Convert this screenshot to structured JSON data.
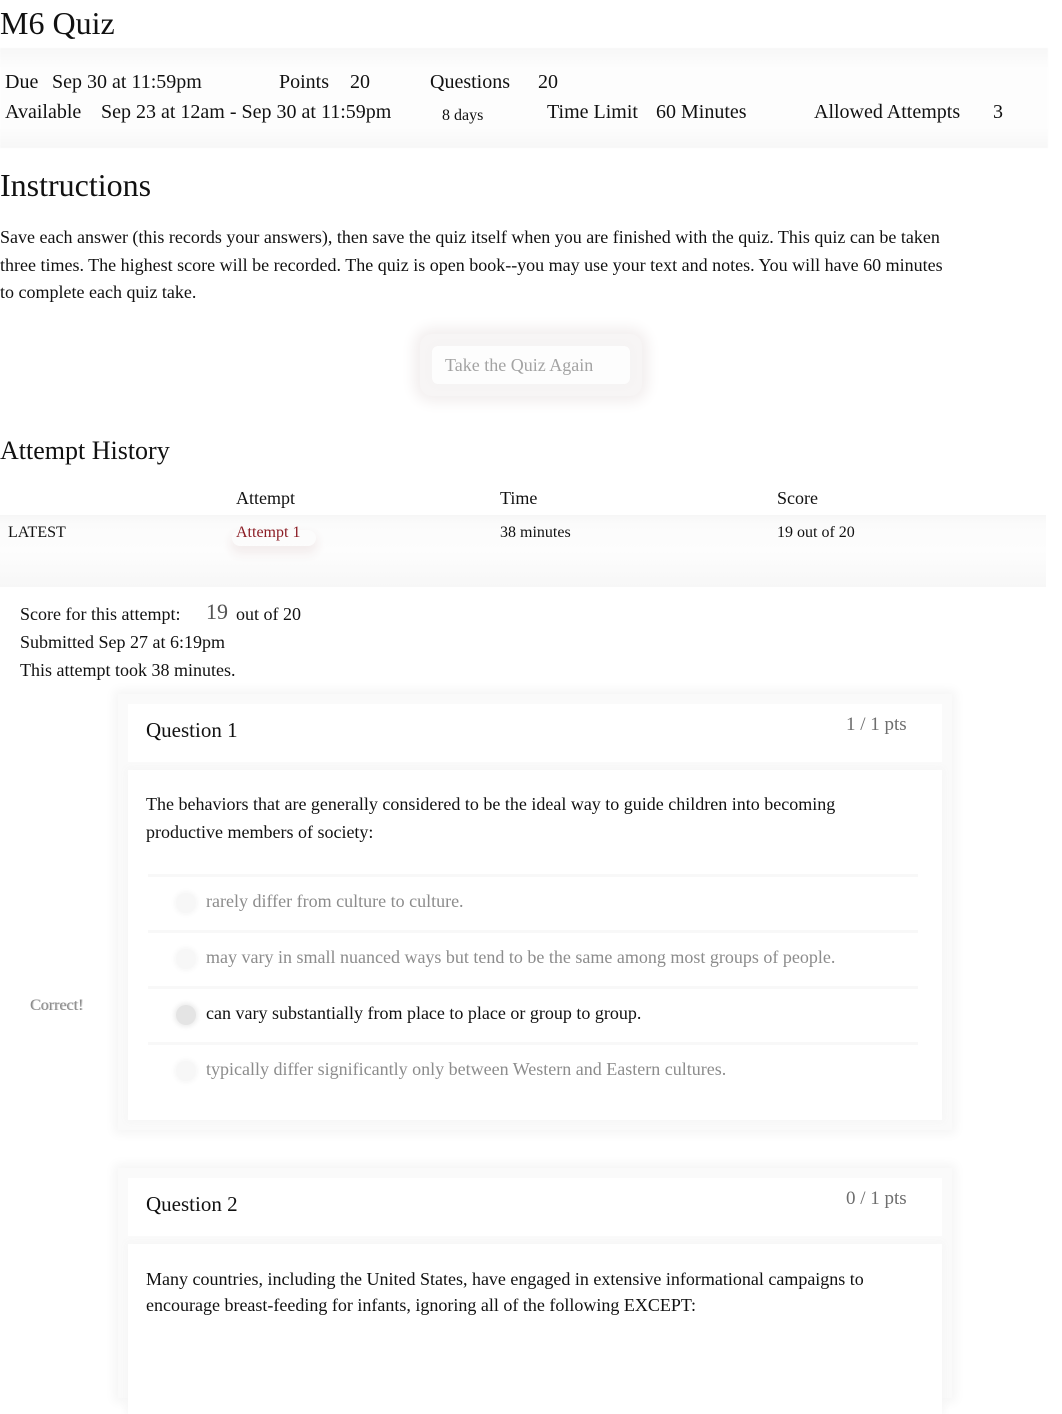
{
  "page": {
    "title": "M6 Quiz"
  },
  "details": {
    "due_label": "Due",
    "due_value": "Sep 30 at 11:59pm",
    "points_label": "Points",
    "points_value": "20",
    "questions_label": "Questions",
    "questions_value": "20",
    "available_label": "Available",
    "available_value": "Sep 23 at 12am - Sep 30 at 11:59pm",
    "available_duration": "8 days",
    "time_limit_label": "Time Limit",
    "time_limit_value": "60 Minutes",
    "allowed_attempts_label": "Allowed Attempts",
    "allowed_attempts_value": "3"
  },
  "instructions": {
    "heading": "Instructions",
    "text": "Save each answer (this records your answers), then save the quiz itself when you are finished with the quiz. This quiz can be taken three times. The highest score will be recorded. The quiz is open book--you may use your text and notes. You will have 60 minutes to complete each quiz take."
  },
  "actions": {
    "take_again_label": "Take the Quiz Again"
  },
  "attempt_history": {
    "heading": "Attempt History",
    "columns": [
      "",
      "Attempt",
      "Time",
      "Score"
    ],
    "rows": [
      {
        "tag": "LATEST",
        "attempt": "Attempt 1",
        "time": "38 minutes",
        "score": "19 out of 20"
      }
    ]
  },
  "attempt_summary": {
    "score_label": "Score for this attempt:",
    "score_value": "19",
    "score_total": "out of 20",
    "submitted": "Submitted Sep 27 at 6:19pm",
    "duration": "This attempt took 38 minutes."
  },
  "questions": [
    {
      "title": "Question 1",
      "points": "1 / 1 pts",
      "text": "The behaviors that are generally considered to be the ideal way to guide children into becoming productive members of society:",
      "feedback_label": "Correct!",
      "answers": [
        {
          "text": "rarely differ from culture to culture.",
          "selected": false
        },
        {
          "text": "may vary in small nuanced ways but tend to be the same among most groups of people.",
          "selected": false
        },
        {
          "text": "can vary substantially from place to place or group to group.",
          "selected": true
        },
        {
          "text": "typically differ significantly only between Western and Eastern cultures.",
          "selected": false
        }
      ]
    },
    {
      "title": "Question 2",
      "points": "0 / 1 pts",
      "text": "Many countries, including the United States, have engaged in extensive informational campaigns to encourage breast-feeding for infants, ignoring all of the following EXCEPT:"
    }
  ],
  "colors": {
    "link": "#8b1c24",
    "muted_text": "#8c8c8c",
    "points_text": "#6e6e6e",
    "button_text": "#a3a3a3"
  }
}
